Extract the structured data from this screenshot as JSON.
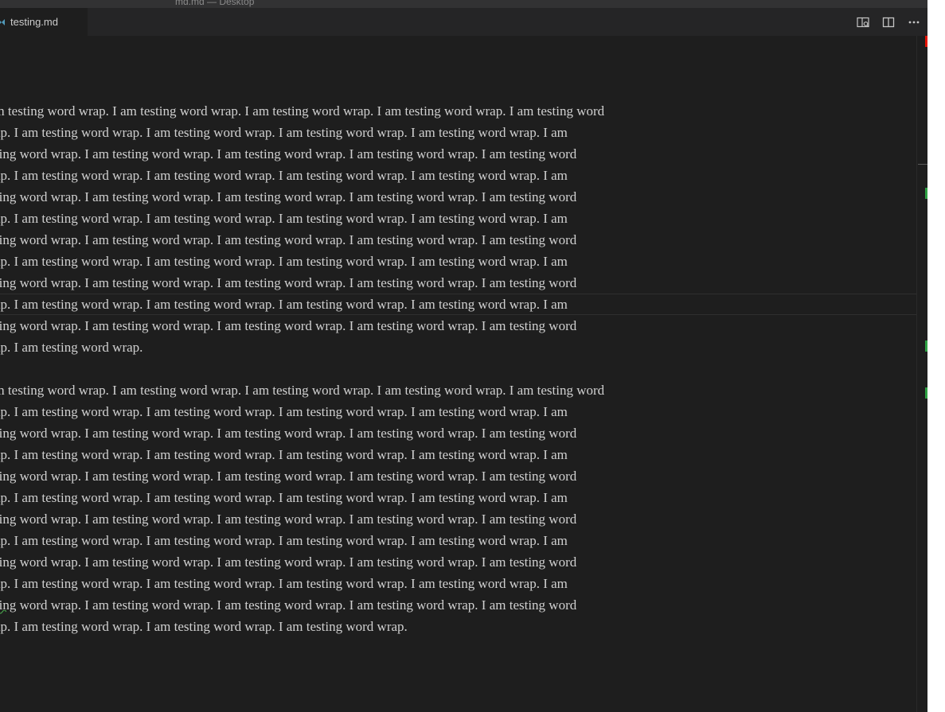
{
  "window": {
    "title": "md.md — Desktop"
  },
  "tabs": [
    {
      "label": "testing.md",
      "icon": "markdown-file-icon",
      "icon_color": "#519aba"
    }
  ],
  "actions": [
    {
      "name": "open-preview-to-side-icon"
    },
    {
      "name": "split-editor-icon"
    },
    {
      "name": "more-actions-icon"
    }
  ],
  "editor": {
    "text_color": "#d0d0d0",
    "background": "#1e1e1e",
    "lines": [
      "",
      "I am testing word wrap. I am testing word wrap. I am testing word wrap. I am testing word wrap. I am testing word",
      "wrap. I am testing word wrap. I am testing word wrap. I am testing word wrap. I am testing word wrap. I am",
      "testing word wrap. I am testing word wrap. I am testing word wrap. I am testing word wrap. I am testing word",
      "wrap. I am testing word wrap. I am testing word wrap. I am testing word wrap. I am testing word wrap. I am",
      "testing word wrap. I am testing word wrap. I am testing word wrap. I am testing word wrap. I am testing word",
      "wrap. I am testing word wrap. I am testing word wrap. I am testing word wrap. I am testing word wrap. I am",
      "testing word wrap. I am testing word wrap. I am testing word wrap. I am testing word wrap. I am testing word",
      "wrap. I am testing word wrap. I am testing word wrap. I am testing word wrap. I am testing word wrap. I am",
      "testing word wrap. I am testing word wrap. I am testing word wrap. I am testing word wrap. I am testing word",
      "wrap. I am testing word wrap. I am testing word wrap. I am testing word wrap. I am testing word wrap. I am",
      "testing word wrap. I am testing word wrap. I am testing word wrap. I am testing word wrap. I am testing word",
      "wrap. I am testing word wrap.",
      "",
      "I am testing word wrap. I am testing word wrap. I am testing word wrap. I am testing word wrap. I am testing word",
      "wrap. I am testing word wrap. I am testing word wrap. I am testing word wrap. I am testing word wrap. I am",
      "testing word wrap. I am testing word wrap. I am testing word wrap. I am testing word wrap. I am testing word",
      "wrap. I am testing word wrap. I am testing word wrap. I am testing word wrap. I am testing word wrap. I am",
      "testing word wrap. I am testing word wrap. I am testing word wrap. I am testing word wrap. I am testing word",
      "wrap. I am testing word wrap. I am testing word wrap. I am testing word wrap. I am testing word wrap. I am",
      "testing word wrap. I am testing word wrap. I am testing word wrap. I am testing word wrap. I am testing word",
      "wrap. I am testing word wrap. I am testing word wrap. I am testing word wrap. I am testing word wrap. I am",
      "testing word wrap. I am testing word wrap. I am testing word wrap. I am testing word wrap. I am testing word",
      "wrap. I am testing word wrap. I am testing word wrap. I am testing word wrap. I am testing word wrap. I am",
      "testing word wrap. I am testing word wrap. I am testing word wrap. I am testing word wrap. I am testing word",
      "wrap. I am testing word wrap. I am testing word wrap. I am testing word wrap."
    ]
  },
  "scrollbar": {
    "markers": [
      {
        "kind": "error",
        "color": "#e51400"
      },
      {
        "kind": "added",
        "color": "#2ea043"
      },
      {
        "kind": "added",
        "color": "#2ea043"
      },
      {
        "kind": "added",
        "color": "#2ea043"
      }
    ]
  }
}
